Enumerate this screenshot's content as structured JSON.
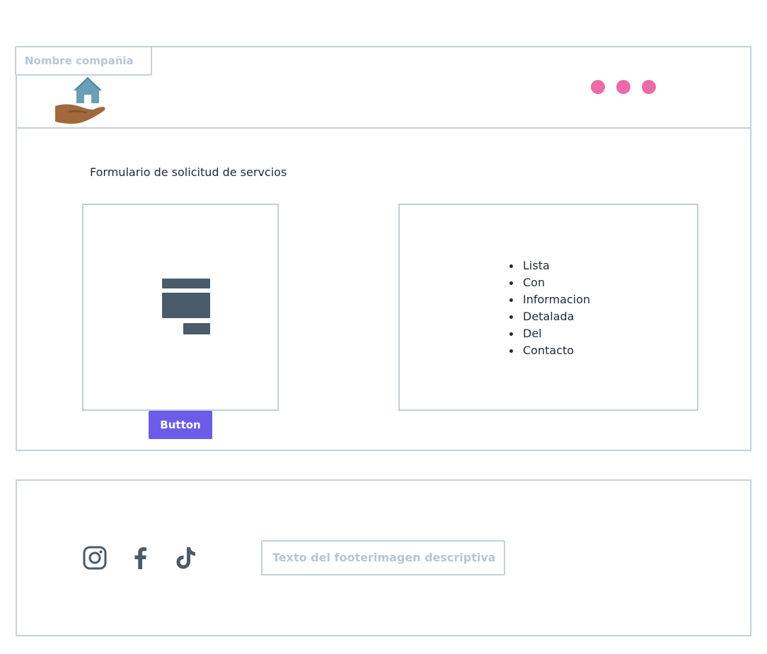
{
  "header": {
    "company_placeholder": "Nombre compañia",
    "logo_icon": "house-in-hand-icon",
    "menu_icon": "three-dots-icon",
    "dot_color": "#ec6aa8"
  },
  "main": {
    "form_title": "Formulario de solicitud de servcios",
    "image_placeholder_icon": "image-placeholder-icon",
    "button_label": "Button",
    "button_color": "#6c5ce7",
    "list_items": [
      "Lista",
      "Con",
      "Informacion",
      "Detalada",
      "Del",
      "Contacto"
    ]
  },
  "footer": {
    "social_icons": [
      "instagram-icon",
      "facebook-icon",
      "tiktok-icon"
    ],
    "text": "Texto del footerimagen descriptiva"
  }
}
